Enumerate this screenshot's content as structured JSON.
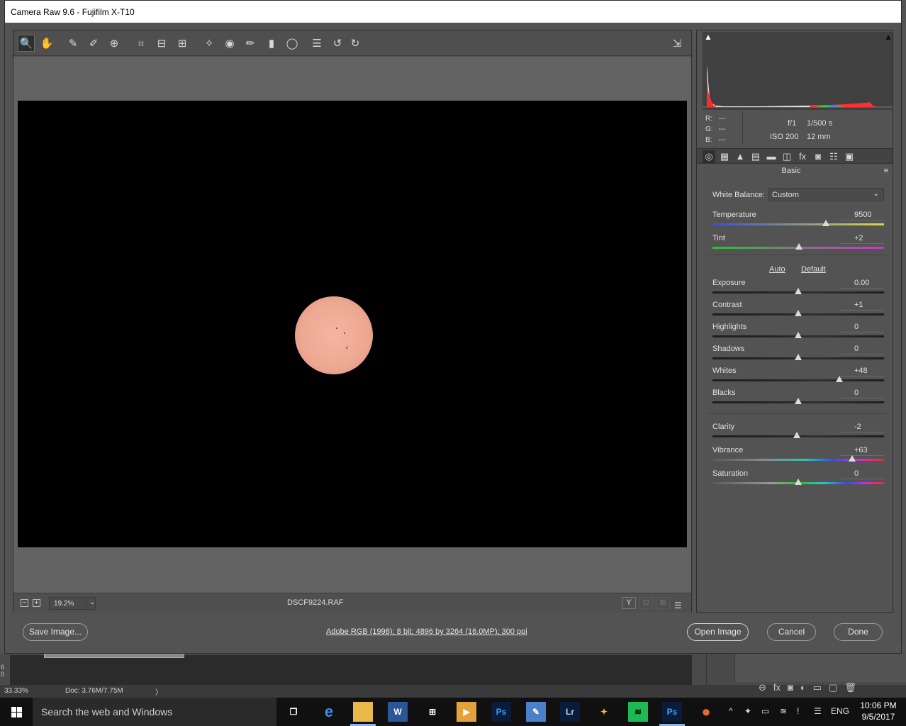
{
  "window": {
    "title": "Camera Raw 9.6  -  Fujifilm X-T10"
  },
  "toolbar": {
    "tools": [
      {
        "name": "zoom-tool-icon",
        "glyph": "🔍"
      },
      {
        "name": "hand-tool-icon",
        "glyph": "✋"
      },
      {
        "name": "white-balance-tool-icon",
        "glyph": "✎"
      },
      {
        "name": "color-sampler-tool-icon",
        "glyph": "✐"
      },
      {
        "name": "targeted-adjustment-tool-icon",
        "glyph": "⊕"
      },
      {
        "name": "crop-tool-icon",
        "glyph": "⌗"
      },
      {
        "name": "straighten-tool-icon",
        "glyph": "⊟"
      },
      {
        "name": "transform-tool-icon",
        "glyph": "⊞"
      },
      {
        "name": "spot-removal-tool-icon",
        "glyph": "✧"
      },
      {
        "name": "red-eye-removal-icon",
        "glyph": "◉"
      },
      {
        "name": "adjustment-brush-icon",
        "glyph": "✏"
      },
      {
        "name": "graduated-filter-icon",
        "glyph": "▮"
      },
      {
        "name": "radial-filter-icon",
        "glyph": "◯"
      },
      {
        "name": "preferences-icon",
        "glyph": "☰"
      },
      {
        "name": "rotate-ccw-icon",
        "glyph": "↺"
      },
      {
        "name": "rotate-cw-icon",
        "glyph": "↻"
      }
    ],
    "fullscreen_glyph": "⇲"
  },
  "preview": {
    "zoom": "19.2%",
    "zoom_minus": "−",
    "zoom_plus": "+",
    "zoom_chevron": "⌄",
    "filename": "DSCF9224.RAF",
    "view_buttons": [
      "Y",
      "⊡",
      "⊞"
    ],
    "frames_glyph": "☰"
  },
  "histogram": {
    "clip_shadow_glyph": "▲",
    "clip_highlight_glyph": "▲"
  },
  "info": {
    "r_label": "R:",
    "r_value": "---",
    "g_label": "G:",
    "g_value": "---",
    "b_label": "B:",
    "b_value": "---",
    "aperture": "f/1",
    "shutter": "1/500 s",
    "iso": "ISO 200",
    "focal": "12 mm"
  },
  "panel_tabs": [
    "◎",
    "▦",
    "▲",
    "▤",
    "▬",
    "◫",
    "fx",
    "◙",
    "☷",
    "▣"
  ],
  "panel": {
    "title": "Basic",
    "menu_glyph": "≡",
    "white_balance_label": "White Balance:",
    "white_balance_value": "Custom",
    "white_balance_chevron": "⌄",
    "auto_label": "Auto",
    "default_label": "Default",
    "sliders": [
      {
        "key": "temperature",
        "label": "Temperature",
        "value": "9500",
        "pos": 0.66,
        "track": "temperature"
      },
      {
        "key": "tint",
        "label": "Tint",
        "value": "+2",
        "pos": 0.505,
        "track": "tint"
      },
      {
        "key": "exposure",
        "label": "Exposure",
        "value": "0.00",
        "pos": 0.5,
        "track": "plain"
      },
      {
        "key": "contrast",
        "label": "Contrast",
        "value": "+1",
        "pos": 0.502,
        "track": "plain"
      },
      {
        "key": "highlights",
        "label": "Highlights",
        "value": "0",
        "pos": 0.5,
        "track": "plain"
      },
      {
        "key": "shadows",
        "label": "Shadows",
        "value": "0",
        "pos": 0.5,
        "track": "plain"
      },
      {
        "key": "whites",
        "label": "Whites",
        "value": "+48",
        "pos": 0.74,
        "track": "plain"
      },
      {
        "key": "blacks",
        "label": "Blacks",
        "value": "0",
        "pos": 0.5,
        "track": "plain"
      },
      {
        "key": "clarity",
        "label": "Clarity",
        "value": "-2",
        "pos": 0.49,
        "track": "plain"
      },
      {
        "key": "vibrance",
        "label": "Vibrance",
        "value": "+63",
        "pos": 0.815,
        "track": "vibrance"
      },
      {
        "key": "saturation",
        "label": "Saturation",
        "value": "0",
        "pos": 0.5,
        "track": "saturation"
      }
    ]
  },
  "footer": {
    "save_image": "Save Image...",
    "workflow": "Adobe RGB (1998); 8 bit; 4896 by 3264 (16.0MP); 300 ppi",
    "open_image": "Open Image",
    "cancel": "Cancel",
    "done": "Done"
  },
  "photoshop": {
    "zoom": "33.33%",
    "doc_size": "Doc: 3.76M/7.75M",
    "doc_arrow": "〉",
    "side_digits": "6\n0",
    "layer_icons": [
      "⊖",
      "fx",
      "◙",
      "◐",
      "▭",
      "▢",
      "🗑"
    ]
  },
  "taskbar": {
    "search_placeholder": "Search the web and Windows",
    "apps": [
      {
        "name": "task-view-icon",
        "glyph": "❐",
        "bg": "transparent",
        "color": "#ffffff"
      },
      {
        "name": "edge-icon",
        "glyph": "e",
        "bg": "transparent",
        "color": "#3c8ee8"
      },
      {
        "name": "file-explorer-icon",
        "glyph": "▬",
        "bg": "#e8b84a",
        "color": "#e8b84a"
      },
      {
        "name": "word-icon",
        "glyph": "W",
        "bg": "#2b5797",
        "color": "#ffffff"
      },
      {
        "name": "store-icon",
        "glyph": "⊞",
        "bg": "transparent",
        "color": "#ffffff"
      },
      {
        "name": "media-player-icon",
        "glyph": "▶",
        "bg": "#e6a23a",
        "color": "#ffffff"
      },
      {
        "name": "photoshop-icon",
        "glyph": "Ps",
        "bg": "#0b1b3a",
        "color": "#31a8ff"
      },
      {
        "name": "paint-icon",
        "glyph": "✎",
        "bg": "#4b7fc8",
        "color": "#ffffff"
      },
      {
        "name": "lightroom-icon",
        "glyph": "Lr",
        "bg": "#0b1b3a",
        "color": "#add5ec"
      },
      {
        "name": "photos-icon",
        "glyph": "✦",
        "bg": "transparent",
        "color": "#f0b93a"
      },
      {
        "name": "spotify-icon",
        "glyph": "≋",
        "bg": "#1db954",
        "color": "#000000"
      },
      {
        "name": "photoshop-active-icon",
        "glyph": "Ps",
        "bg": "#0b1b3a",
        "color": "#31a8ff"
      },
      {
        "name": "firefox-icon",
        "glyph": "●",
        "bg": "transparent",
        "color": "#e66a2c"
      }
    ],
    "tray": [
      "^",
      "✦",
      "▭",
      "≋",
      "!",
      "☰"
    ],
    "language": "ENG",
    "time": "10:06 PM",
    "date": "9/5/2017"
  }
}
